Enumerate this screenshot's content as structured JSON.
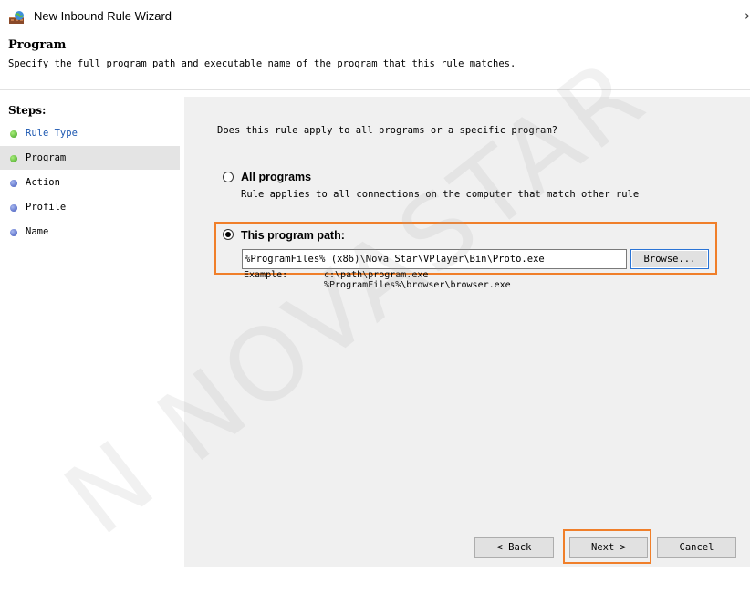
{
  "window": {
    "title": "New Inbound Rule Wizard",
    "close_glyph": "›"
  },
  "header": {
    "heading": "Program",
    "subheading": "Specify the full program path and executable name of the program that this rule matches."
  },
  "steps": {
    "title": "Steps:",
    "items": [
      {
        "label": "Rule Type",
        "state": "done"
      },
      {
        "label": "Program",
        "state": "active"
      },
      {
        "label": "Action",
        "state": "pending"
      },
      {
        "label": "Profile",
        "state": "pending"
      },
      {
        "label": "Name",
        "state": "pending"
      }
    ]
  },
  "main": {
    "question": "Does this rule apply to all programs or a specific program?",
    "all_programs": {
      "label": "All programs",
      "description": "Rule applies to all connections on the computer that match other rule",
      "checked": false
    },
    "program_path": {
      "label": "This program path:",
      "value": "%ProgramFiles% (x86)\\Nova Star\\VPlayer\\Bin\\Proto.exe",
      "checked": true
    },
    "browse_label": "Browse...",
    "example_label": "Example:",
    "example_line1": "c:\\path\\program.exe",
    "example_line2": "%ProgramFiles%\\browser\\browser.exe"
  },
  "buttons": {
    "back": "< Back",
    "next": "Next >",
    "cancel": "Cancel"
  },
  "watermark": "N NOVASTAR",
  "colors": {
    "highlight": "#f07f2a",
    "step_done": "#3c9d1e",
    "step_pending": "#3b52b8",
    "link_blue": "#1a56b0"
  }
}
